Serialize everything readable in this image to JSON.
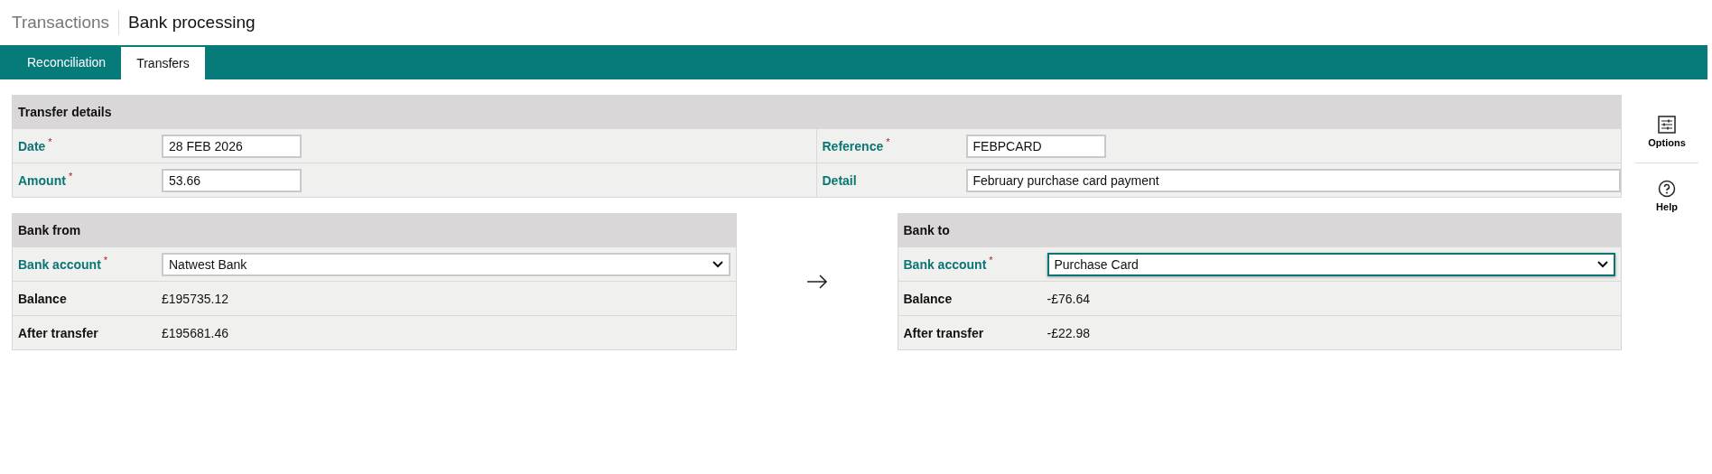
{
  "breadcrumb": {
    "parent": "Transactions",
    "title": "Bank processing"
  },
  "tabs": [
    {
      "label": "Reconciliation",
      "selected": false
    },
    {
      "label": "Transfers",
      "selected": true
    }
  ],
  "transfer_details": {
    "title": "Transfer details",
    "fields": [
      {
        "label": "Date",
        "required_mark": "*",
        "value": "28 FEB 2026",
        "kind": "short"
      },
      {
        "label": "Reference",
        "required_mark": "*",
        "value": "FEBPCARD",
        "kind": "short"
      },
      {
        "label": "Amount",
        "required_mark": "*",
        "value": "53.66",
        "kind": "short"
      },
      {
        "label": "Detail",
        "value": "February purchase card payment",
        "kind": "wide"
      }
    ]
  },
  "bank_from": {
    "title": "Bank from",
    "account_label": "Bank account",
    "required_mark": "*",
    "account": "Natwest Bank",
    "focused": false,
    "rows": [
      {
        "label": "Balance",
        "value": "£195735.12"
      },
      {
        "label": "After transfer",
        "value": "£195681.46"
      }
    ]
  },
  "bank_to": {
    "title": "Bank to",
    "account_label": "Bank account",
    "required_mark": "*",
    "account": "Purchase Card",
    "focused": true,
    "rows": [
      {
        "label": "Balance",
        "value": "-£76.64"
      },
      {
        "label": "After transfer",
        "value": "-£22.98"
      }
    ]
  },
  "side_actions": [
    {
      "kind": "options",
      "label": "Options"
    },
    {
      "kind": "help",
      "label": "Help"
    }
  ]
}
